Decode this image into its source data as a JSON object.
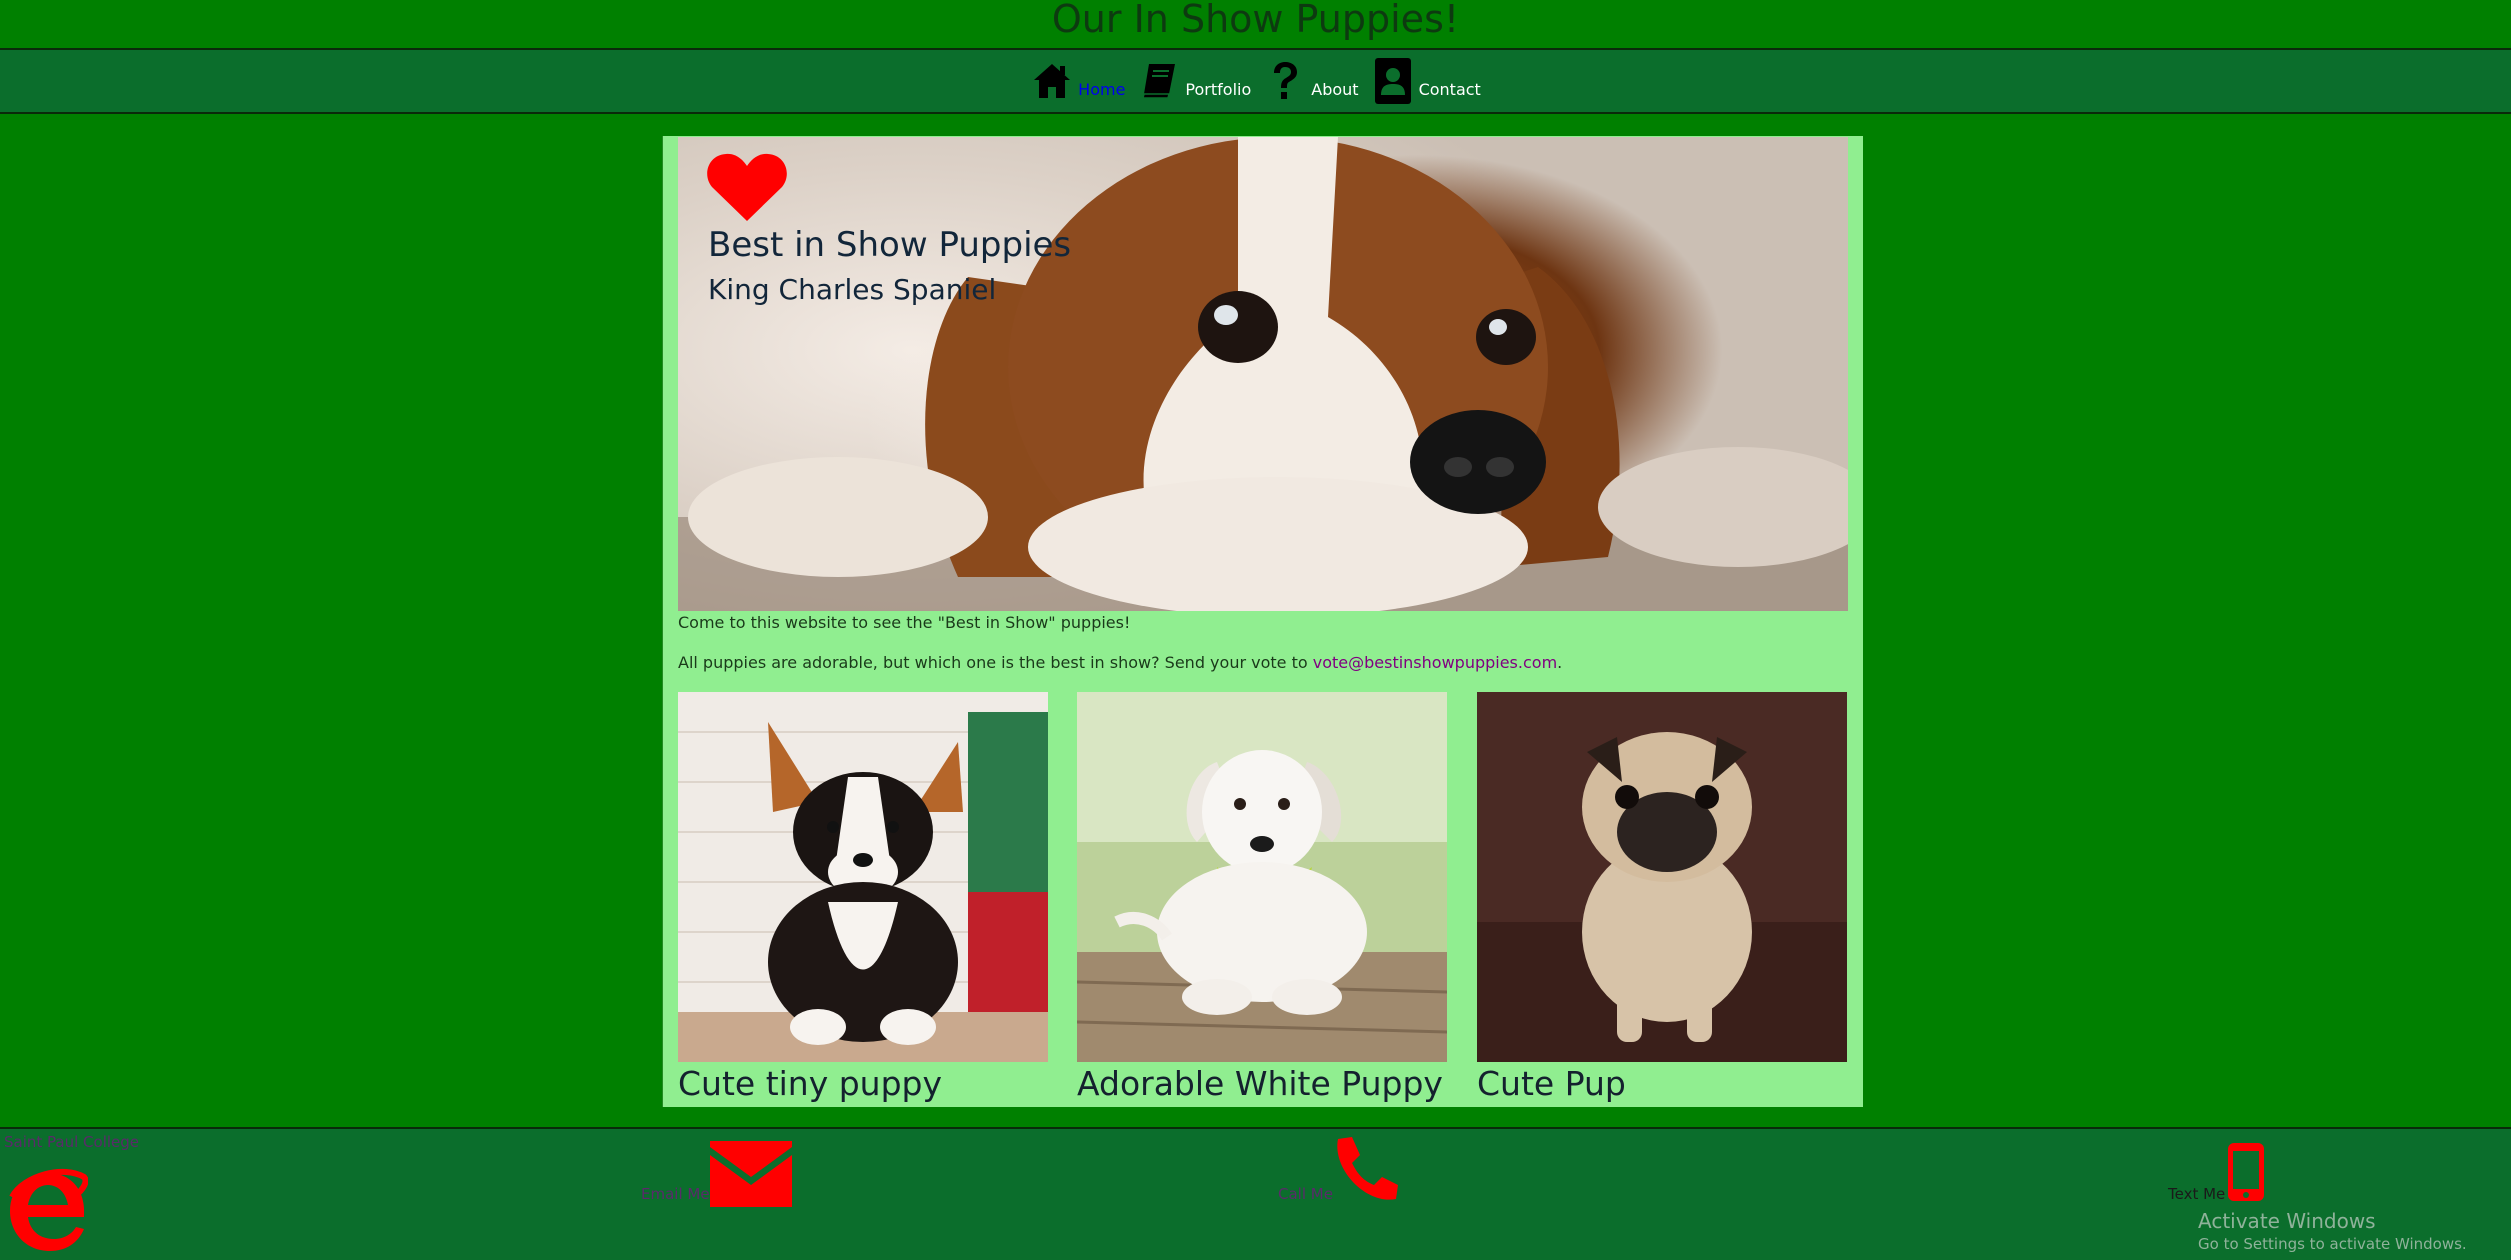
{
  "header": {
    "title": "Our In Show Puppies!"
  },
  "nav": {
    "items": [
      {
        "label": "Home",
        "icon": "home-icon",
        "active": true
      },
      {
        "label": "Portfolio",
        "icon": "book-icon",
        "active": false
      },
      {
        "label": "About",
        "icon": "question-icon",
        "active": false
      },
      {
        "label": "Contact",
        "icon": "contact-card-icon",
        "active": false
      }
    ]
  },
  "hero": {
    "icon": "heart-icon",
    "title": "Best in Show Puppies",
    "subtitle": "King Charles Spaniel"
  },
  "content": {
    "intro": "Come to this website to see the \"Best in Show\" puppies!",
    "vote_text": "All puppies are adorable, but which one is the best in show? Send your vote to ",
    "vote_email": "vote@bestinshowpuppies.com",
    "vote_end": "."
  },
  "cards": [
    {
      "caption": "Cute tiny puppy"
    },
    {
      "caption": "Adorable White Puppy"
    },
    {
      "caption": "Cute Pup"
    }
  ],
  "footer": {
    "college": "Saint Paul College",
    "email_label": "Email Me",
    "call_label": "Call Me",
    "text_label": "Text Me",
    "icons": [
      "internet-explorer-icon",
      "envelope-icon",
      "phone-icon",
      "mobile-phone-icon"
    ]
  },
  "watermark": {
    "title": "Activate Windows",
    "subtitle": "Go to Settings to activate Windows."
  },
  "colors": {
    "page_bg": "#008000",
    "nav_bg": "#0b6e2c",
    "panel_bg": "#90ee90",
    "icon_red": "#ff0000",
    "link_purple": "#800080",
    "active_link": "#0000ee"
  }
}
